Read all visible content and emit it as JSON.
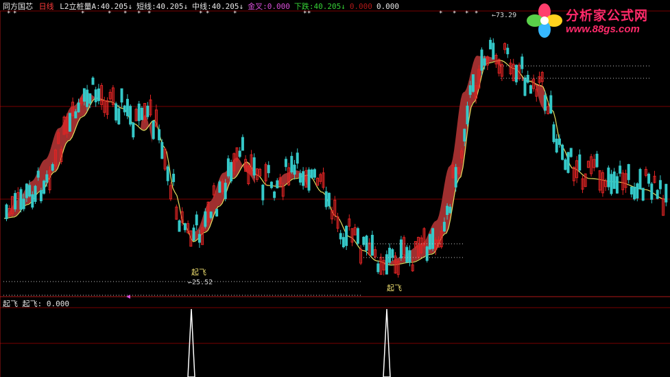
{
  "header": {
    "stock_name": "同方国芯",
    "period": "日线",
    "items": [
      {
        "label": "L2立桩量A",
        "value": "40.205↓",
        "color": "#e8e8e8"
      },
      {
        "label": "短线",
        "value": "40.205↓",
        "color": "#e8e8e8"
      },
      {
        "label": "中线",
        "value": "40.205↓",
        "color": "#e8e8e8"
      },
      {
        "label": "金叉",
        "value": "0.000",
        "color": "#d94fd9"
      },
      {
        "label": "下跌",
        "value": "40.205↓",
        "color": "#36d136"
      },
      {
        "label": "",
        "value": "0.000",
        "color": "#b01818"
      },
      {
        "label": "",
        "value": "0.000",
        "color": "#e8e8e8"
      }
    ]
  },
  "sub_header": {
    "indicator": "起飞",
    "label": "起飞",
    "value": "0.000"
  },
  "logo": {
    "text": "分析家公式网",
    "url": "www.88gs.com"
  },
  "colors": {
    "up": "#e02424",
    "down": "#35c8c8",
    "ribbon": "#a83232",
    "ma": "#e8e060",
    "grid": "#7a0000",
    "signal": "#ffffff",
    "marker_text": "#f0e070"
  },
  "chart_data": {
    "type": "candlestick",
    "y_axis": "price (linear)",
    "annotations": [
      {
        "text": "73.29",
        "kind": "high"
      },
      {
        "text": "25.52",
        "kind": "low"
      },
      {
        "text": "起飞",
        "kind": "signal"
      },
      {
        "text": "起飞",
        "kind": "signal"
      }
    ],
    "signal_series": {
      "name": "起飞",
      "peaks": 2
    }
  }
}
